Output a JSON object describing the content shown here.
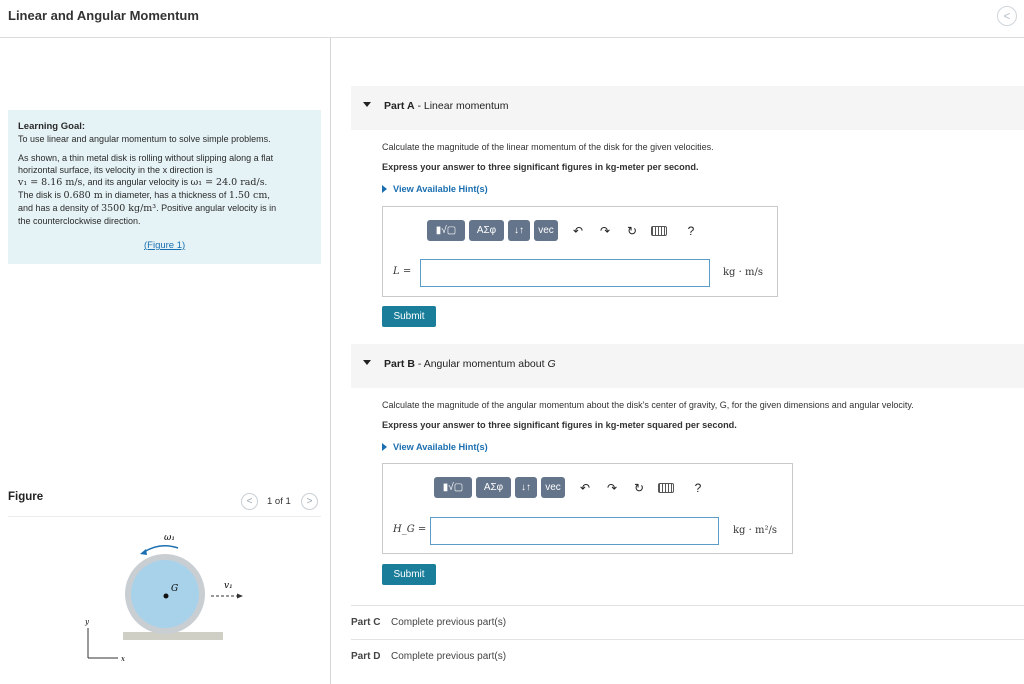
{
  "header": {
    "title": "Linear and Angular Momentum",
    "nav_prev": "<"
  },
  "learning_goal": {
    "title": "Learning Goal:",
    "intro": "To use linear and angular momentum to solve simple problems.",
    "p1": "As shown, a thin metal disk is rolling without slipping along a flat",
    "p2": "horizontal surface, its velocity in the x direction is",
    "p3a": "v₁ = 8.16 m/s",
    "p3b": ", and its angular velocity is ",
    "p3c": "ω₁ = 24.0 rad/s",
    "p3d": ".",
    "p4a": "The disk is ",
    "p4b": "0.680 m",
    "p4c": " in diameter, has a thickness of ",
    "p4d": "1.50 cm",
    "p4e": ",",
    "p5a": "and has a density of ",
    "p5b": "3500 kg/m³",
    "p5c": ". Positive angular velocity is in",
    "p6": "the counterclockwise direction.",
    "figure_link": "(Figure 1)"
  },
  "figure": {
    "label": "Figure",
    "prev": "<",
    "next": ">",
    "count": "1 of 1",
    "omega_label": "ω₁",
    "v_label": "v₁",
    "g_label": "G",
    "y_label": "y",
    "x_label": "x",
    "colors": {
      "disk": "#a8d2ea",
      "rim": "#c9ced3",
      "ground": "#cfcfc6",
      "arrow": "#1b6fb0"
    }
  },
  "partA": {
    "letter": "Part A",
    "title": " - Linear momentum",
    "question": "Calculate the magnitude of the linear momentum of the disk for the given velocities.",
    "instruction": "Express your answer to three significant figures in kg-meter per second.",
    "hint": "View Available Hint(s)",
    "variable": "L =",
    "unit": "kg · m/s",
    "submit": "Submit"
  },
  "partB": {
    "letter": "Part B",
    "title_prefix": " - Angular momentum about ",
    "title_var": "G",
    "question": "Calculate the magnitude of the angular momentum about the disk's center of gravity, G, for the given dimensions and angular velocity.",
    "instruction": "Express your answer to three significant figures in kg-meter squared per second.",
    "hint": "View Available Hint(s)",
    "variable": "H_G =",
    "unit": "kg · m²/s",
    "submit": "Submit"
  },
  "toolbar": {
    "templates": "▮√▢",
    "greek": "ΑΣφ",
    "arrows": "↓↑",
    "vec": "vec",
    "undo": "↶",
    "redo": "↷",
    "reset": "↻",
    "help": "?"
  },
  "partC": {
    "letter": "Part C",
    "status": "Complete previous part(s)"
  },
  "partD": {
    "letter": "Part D",
    "status": "Complete previous part(s)"
  }
}
